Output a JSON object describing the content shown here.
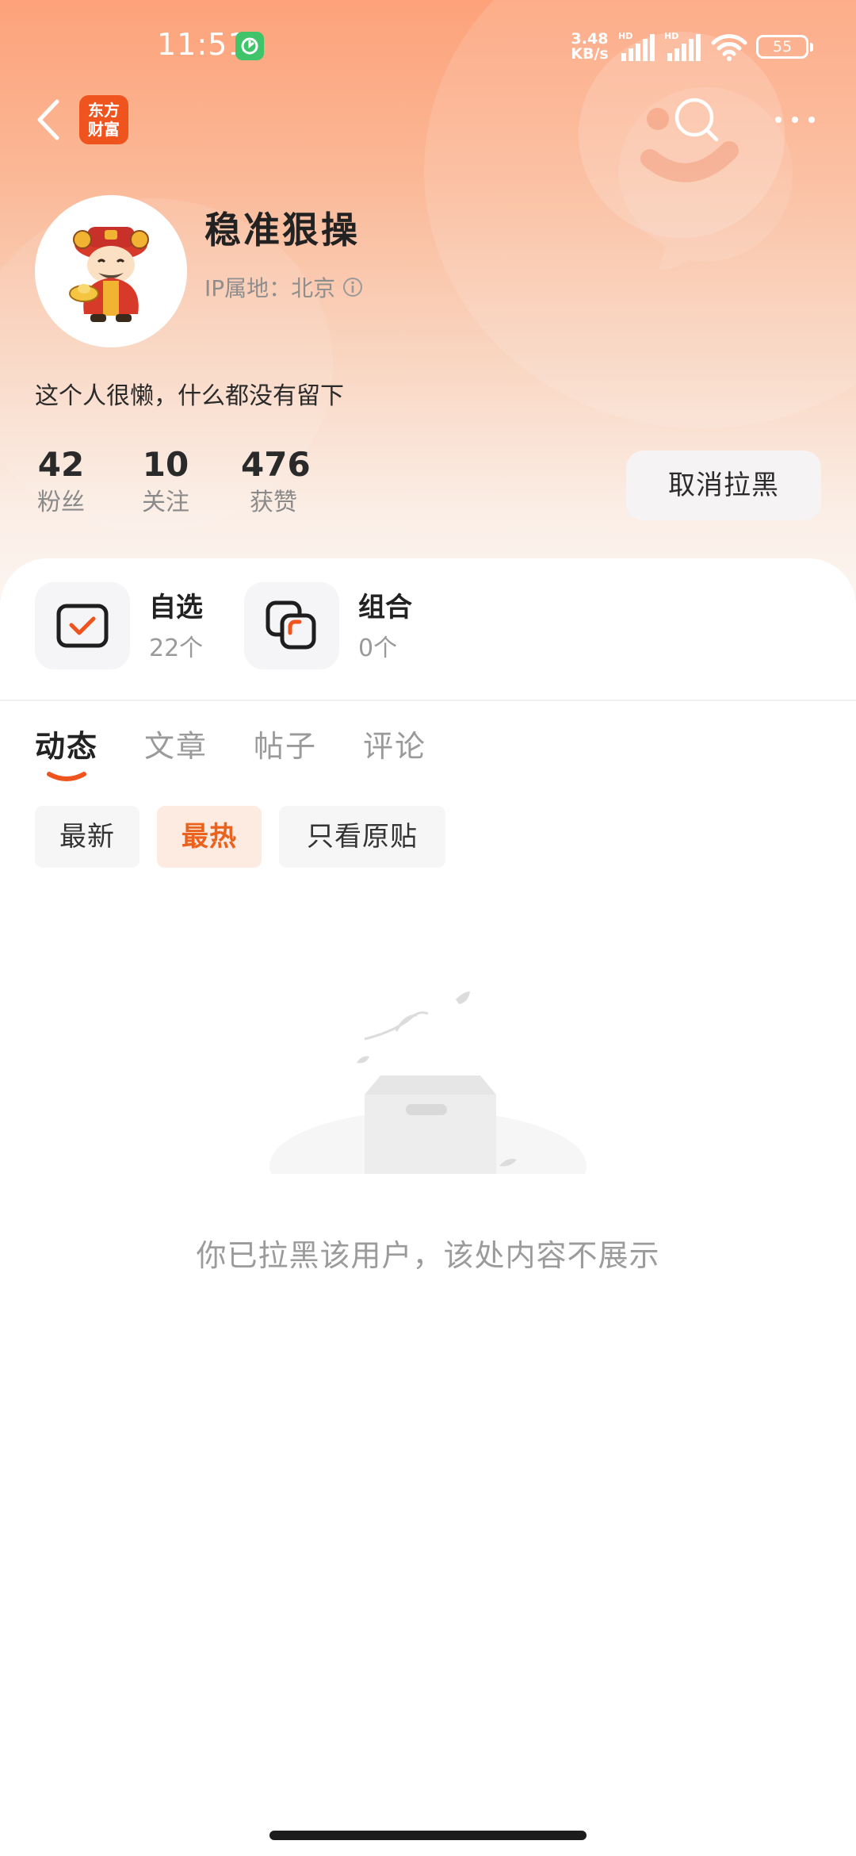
{
  "status_bar": {
    "time": "11:51",
    "net_speed_value": "3.48",
    "net_speed_unit": "KB/s",
    "signal_tag_1": "HD",
    "signal_tag_2": "HD",
    "battery": "55"
  },
  "nav": {
    "brand_line1": "东方",
    "brand_line2": "财富"
  },
  "profile": {
    "name": "稳准狠操",
    "ip_label": "IP属地：北京",
    "bio": "这个人很懒，什么都没有留下",
    "stats": [
      {
        "value": "42",
        "label": "粉丝"
      },
      {
        "value": "10",
        "label": "关注"
      },
      {
        "value": "476",
        "label": "获赞"
      }
    ],
    "unblock_button": "取消拉黑"
  },
  "shortcuts": [
    {
      "title": "自选",
      "count": "22个",
      "icon": "watchlist-check-icon"
    },
    {
      "title": "组合",
      "count": "0个",
      "icon": "portfolio-squares-icon"
    }
  ],
  "tabs": [
    {
      "label": "动态",
      "active": true
    },
    {
      "label": "文章",
      "active": false
    },
    {
      "label": "帖子",
      "active": false
    },
    {
      "label": "评论",
      "active": false
    }
  ],
  "filters": [
    {
      "label": "最新",
      "active": false
    },
    {
      "label": "最热",
      "active": true
    },
    {
      "label": "只看原贴",
      "active": false
    }
  ],
  "empty_state": {
    "message": "你已拉黑该用户，该处内容不展示"
  },
  "colors": {
    "accent": "#f0541e",
    "active_filter_text": "#e9631f",
    "active_filter_bg": "#fdeae0",
    "header_gradient_top": "#fda27a",
    "header_gradient_bottom": "#fbf5f1"
  }
}
